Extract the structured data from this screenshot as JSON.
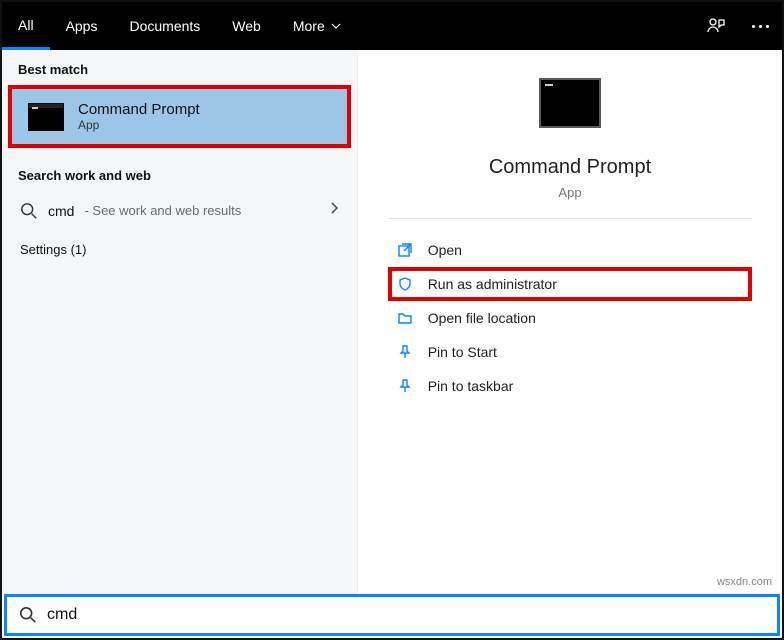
{
  "topbar": {
    "tabs": [
      "All",
      "Apps",
      "Documents",
      "Web",
      "More"
    ],
    "active_index": 0
  },
  "left": {
    "best_match_label": "Best match",
    "best_match": {
      "title": "Command Prompt",
      "subtitle": "App"
    },
    "search_web_label": "Search work and web",
    "search_term": "cmd",
    "search_hint": "- See work and web results",
    "settings_label": "Settings (1)"
  },
  "right": {
    "title": "Command Prompt",
    "subtitle": "App",
    "actions": [
      {
        "id": "open",
        "label": "Open"
      },
      {
        "id": "run-admin",
        "label": "Run as administrator"
      },
      {
        "id": "open-loc",
        "label": "Open file location"
      },
      {
        "id": "pin-start",
        "label": "Pin to Start"
      },
      {
        "id": "pin-taskbar",
        "label": "Pin to taskbar"
      }
    ]
  },
  "searchbar": {
    "value": "cmd"
  },
  "watermark": "wsxdn.com"
}
